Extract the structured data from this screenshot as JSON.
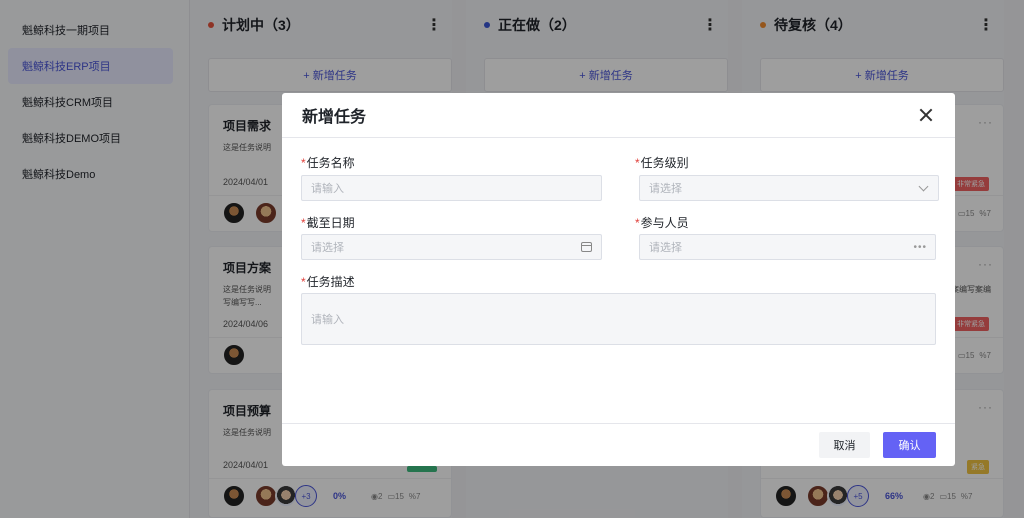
{
  "sidebar": {
    "items": [
      {
        "label": "魁鲸科技一期项目"
      },
      {
        "label": "魁鲸科技ERP项目"
      },
      {
        "label": "魁鲸科技CRM项目"
      },
      {
        "label": "魁鲸科技DEMO项目"
      },
      {
        "label": "魁鲸科技Demo"
      }
    ],
    "active_index": 1
  },
  "board": {
    "add_task_label": "+ 新增任务",
    "columns": [
      {
        "title": "计划中（3）",
        "dot_color": "#e5533d"
      },
      {
        "title": "正在做（2）",
        "dot_color": "#3a56d6"
      },
      {
        "title": "待复核（4）",
        "dot_color": "#f08c2e"
      }
    ],
    "col1_cards": [
      {
        "title": "项目需求",
        "desc": "这是任务说明",
        "date": "2024/04/01"
      },
      {
        "title": "项目方案",
        "desc": "这是任务说明\n写编写写...",
        "date": "2024/04/06"
      },
      {
        "title": "项目预算",
        "desc": "这是任务说明",
        "date": "2024/04/01",
        "more_count": "+3",
        "progress": "0%",
        "views": "2",
        "comments": "15",
        "links": "7"
      }
    ],
    "col3_cards": [
      {
        "tag": "非常紧急",
        "comments": "15",
        "links": "7"
      },
      {
        "desc": "案编写案编",
        "tag": "非常紧急",
        "comments": "15",
        "links": "7"
      },
      {
        "tag": "紧急",
        "more_count": "+5",
        "progress": "66%",
        "views": "2",
        "comments": "15",
        "links": "7"
      }
    ],
    "tag_colors": {
      "urgent_red": "#f06262",
      "urgent_yellow": "#f1c341"
    }
  },
  "modal": {
    "title": "新增任务",
    "required_mark": "*",
    "fields": {
      "task_name": {
        "label": "任务名称",
        "placeholder": "请输入"
      },
      "task_level": {
        "label": "任务级别",
        "placeholder": "请选择"
      },
      "deadline": {
        "label": "截至日期",
        "placeholder": "请选择"
      },
      "participants": {
        "label": "参与人员",
        "placeholder": "请选择"
      },
      "description": {
        "label": "任务描述",
        "placeholder": "请输入"
      }
    },
    "cancel_label": "取消",
    "confirm_label": "确认",
    "accent_color": "#6462f5"
  }
}
